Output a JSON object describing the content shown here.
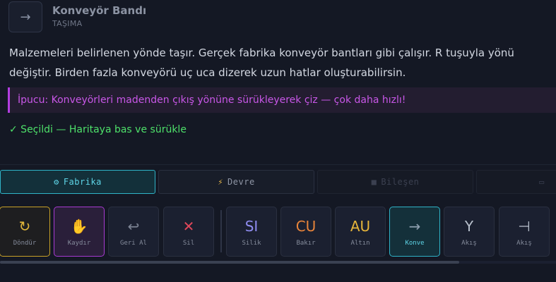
{
  "header": {
    "icon": "arrow-right-icon",
    "icon_glyph": "→",
    "title": "Konveyör Bandı",
    "subtitle": "TAŞIMA"
  },
  "description": "Malzemeleri belirlenen yönde taşır. Gerçek fabrika konveyör bantları gibi çalışır. R tuşuyla yönü değiştir. Birden fazla konveyörü uç uca dizerek uzun hatlar oluşturabilirsin.",
  "tip": "İpucu: Konveyörleri madenden çıkış yönüne sürükleyerek çiz — çok daha hızlı!",
  "status": "✓ Seçildi — Haritaya bas ve sürükle",
  "tabs": [
    {
      "icon": "gear-icon",
      "glyph": "⚙",
      "label": "Fabrika",
      "state": "active"
    },
    {
      "icon": "lightning-icon",
      "glyph": "⚡",
      "label": "Devre",
      "state": "normal"
    },
    {
      "icon": "chip-icon",
      "glyph": "■",
      "label": "Bileşen",
      "state": "disabled"
    },
    {
      "icon": "monitor-icon",
      "glyph": "▭",
      "label": "",
      "state": "disabled"
    }
  ],
  "tools": [
    {
      "glyph": "↻",
      "label": "Döndür",
      "color": "#e0b53a"
    },
    {
      "glyph": "✋",
      "label": "Kaydır",
      "color": "#e8b04a"
    },
    {
      "glyph": "↩",
      "label": "Geri Al",
      "color": "#7d8494"
    },
    {
      "glyph": "✕",
      "label": "Sil",
      "color": "#e0475a"
    },
    {
      "glyph": "SI",
      "label": "Silik",
      "color": "#8f8cf0"
    },
    {
      "glyph": "CU",
      "label": "Bakır",
      "color": "#e8843a"
    },
    {
      "glyph": "AU",
      "label": "Altın",
      "color": "#e6b43a"
    },
    {
      "glyph": "→",
      "label": "Konve",
      "color": "#8fa0b0"
    },
    {
      "glyph": "Y",
      "label": "Akış",
      "color": "#b8c0cc"
    },
    {
      "glyph": "⊣",
      "label": "Akış",
      "color": "#b8c0cc"
    }
  ]
}
